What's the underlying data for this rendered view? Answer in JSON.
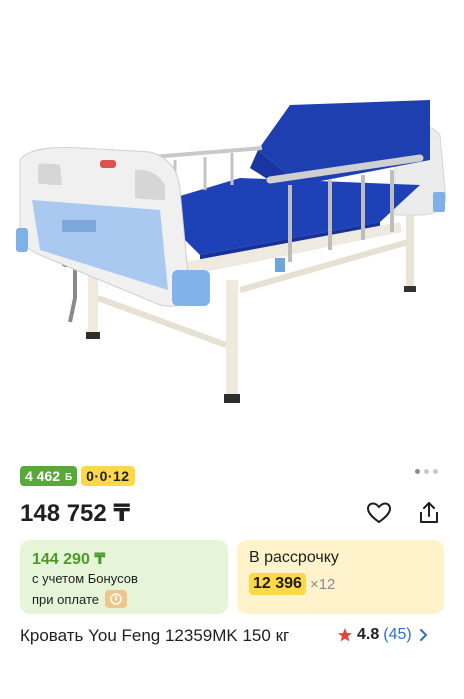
{
  "product": {
    "image_alt": "medical bed",
    "gallery": {
      "total": 3,
      "active": 0
    },
    "badges": {
      "bonus": "4 462",
      "bonus_currency": "Б",
      "installment": "0·0·12"
    },
    "price": "148 752 ₸",
    "bonus_card": {
      "price": "144 290 ₸",
      "line1": "с учетом Бонусов",
      "line2": "при оплате"
    },
    "installment_card": {
      "title": "В рассрочку",
      "amount": "12 396",
      "multiplier": "×12"
    },
    "title": "Кровать You Feng 12359MK 150 кг",
    "rating": {
      "value": "4.8",
      "count": "(45)"
    }
  },
  "icons": [
    "heart-icon",
    "share-icon",
    "star-icon",
    "chevron-right-icon"
  ],
  "colors": {
    "bonus_green": "#58a83a",
    "installment_yellow": "#ffd84a",
    "link_blue": "#2c6fd1",
    "star_red": "#e2463f"
  }
}
